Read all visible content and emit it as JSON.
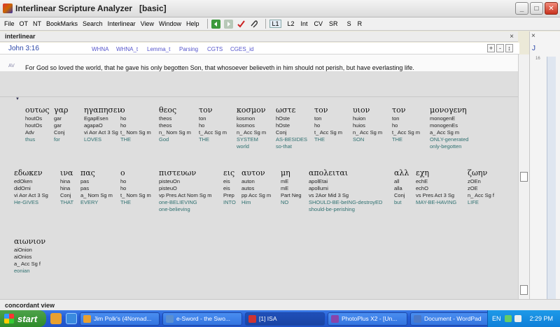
{
  "window": {
    "title": "Interlinear Scripture Analyzer   [basic]",
    "controls": {
      "minimize": "_",
      "maximize": "□",
      "close": "✕"
    }
  },
  "menu": [
    "File",
    "OT",
    "NT",
    "BookMarks",
    "Search",
    "Interlinear",
    "View",
    "Window",
    "Help"
  ],
  "toolbar_icons": [
    "arrow-left-icon",
    "arrow-right-icon",
    "check-icon",
    "paperclip-icon"
  ],
  "toolbar_buttons": [
    "L1",
    "L2",
    "Int",
    "CV",
    "SR",
    "S",
    "R"
  ],
  "panel": {
    "title": "interlinear",
    "close": "×"
  },
  "reference": "John 3:16",
  "ref_links": [
    "WHNA",
    "WHNA_t",
    "Lemma_t",
    "Parsing",
    "CGTS",
    "CGES_id"
  ],
  "ref_controls": [
    "+",
    "-",
    "↕",
    "+"
  ],
  "verse": {
    "version": "AV",
    "text": "For God so loved the world, that he gave his only begotten Son, that whosoever believeth in him should not perish, but have everlasting life."
  },
  "words_row1": [
    {
      "gk": "ουτως",
      "l1": "houtOs",
      "l2": "houtOs",
      "parse": "Adv",
      "en": "thus",
      "en2": ""
    },
    {
      "gk": "γαρ",
      "l1": "gar",
      "l2": "gar",
      "parse": "Conj",
      "en": "for",
      "en2": ""
    },
    {
      "gk": "ηγαπησεν",
      "l1": "EgapEsen",
      "l2": "agapaO",
      "parse": "vi Aor Act 3 Sg",
      "en": "LOVES",
      "en2": ""
    },
    {
      "gk": "ο",
      "l1": "ho",
      "l2": "ho",
      "parse": "t_ Nom Sg m",
      "en": "THE",
      "en2": ""
    },
    {
      "gk": "θεος",
      "l1": "theos",
      "l2": "theos",
      "parse": "n_ Nom Sg m",
      "en": "God",
      "en2": ""
    },
    {
      "gk": "τον",
      "l1": "ton",
      "l2": "ho",
      "parse": "t_ Acc Sg m",
      "en": "THE",
      "en2": ""
    },
    {
      "gk": "κοσμον",
      "l1": "kosmon",
      "l2": "kosmos",
      "parse": "n_ Acc Sg m",
      "en": "SYSTEM",
      "en2": "world"
    },
    {
      "gk": "ωστε",
      "l1": "hOste",
      "l2": "hOste",
      "parse": "Conj",
      "en": "AS-BESIDES",
      "en2": "so-that"
    },
    {
      "gk": "τον",
      "l1": "ton",
      "l2": "ho",
      "parse": "t_ Acc Sg m",
      "en": "THE",
      "en2": ""
    },
    {
      "gk": "υιον",
      "l1": "huion",
      "l2": "huios",
      "parse": "n_ Acc Sg m",
      "en": "SON",
      "en2": ""
    },
    {
      "gk": "τον",
      "l1": "ton",
      "l2": "ho",
      "parse": "t_ Acc Sg m",
      "en": "THE",
      "en2": ""
    },
    {
      "gk": "μονογενη",
      "l1": "monogenE",
      "l2": "monogenEs",
      "parse": "a_ Acc Sg m",
      "en": "ONLY-generated",
      "en2": "only-begotten"
    }
  ],
  "words_row2": [
    {
      "gk": "εδωκεν",
      "l1": "edOken",
      "l2": "didOmi",
      "parse": "vi Aor Act 3 Sg",
      "en": "He-GIVES",
      "en2": ""
    },
    {
      "gk": "ινα",
      "l1": "hina",
      "l2": "hina",
      "parse": "Conj",
      "en": "THAT",
      "en2": ""
    },
    {
      "gk": "πας",
      "l1": "pas",
      "l2": "pas",
      "parse": "a_ Nom Sg m",
      "en": "EVERY",
      "en2": ""
    },
    {
      "gk": "ο",
      "l1": "ho",
      "l2": "ho",
      "parse": "t_ Nom Sg m",
      "en": "THE",
      "en2": ""
    },
    {
      "gk": "πιστευων",
      "l1": "pisteuOn",
      "l2": "pisteuO",
      "parse": "vp Pres Act Nom Sg m",
      "en": "one-BELIEVING",
      "en2": "one-believing"
    },
    {
      "gk": "εις",
      "l1": "eis",
      "l2": "eis",
      "parse": "Prep",
      "en": "INTO",
      "en2": ""
    },
    {
      "gk": "αυτον",
      "l1": "auton",
      "l2": "autos",
      "parse": "pp Acc Sg m",
      "en": "Him",
      "en2": ""
    },
    {
      "gk": "μη",
      "l1": "mE",
      "l2": "mE",
      "parse": "Part Neg",
      "en": "NO",
      "en2": ""
    },
    {
      "gk": "απολειται",
      "l1": "apolEtai",
      "l2": "apollumi",
      "parse": "vs 2Aor Mid 3 Sg",
      "en": "SHOULD-BE-beING-destroyED",
      "en2": "should-be-perishing"
    },
    {
      "gk": "αλλ",
      "l1": "all",
      "l2": "alla",
      "parse": "Conj",
      "en": "but",
      "en2": ""
    },
    {
      "gk": "εχη",
      "l1": "echE",
      "l2": "echO",
      "parse": "vs Pres Act 3 Sg",
      "en": "MAY-BE-HAVING",
      "en2": ""
    },
    {
      "gk": "ζωην",
      "l1": "zOEn",
      "l2": "zOE",
      "parse": "n_ Acc Sg f",
      "en": "LIFE",
      "en2": ""
    }
  ],
  "words_row3": [
    {
      "gk": "αιωνιον",
      "l1": "aiOnion",
      "l2": "aiOnios",
      "parse": "a_ Acc Sg f",
      "en": "eonian",
      "en2": ""
    }
  ],
  "right_panel": {
    "close": "×",
    "ref": "J",
    "num": "16"
  },
  "concordance": {
    "title": "concordant view"
  },
  "taskbar": {
    "start": "start",
    "tasks": [
      "Jim Polk's (4Nomad...",
      "e-Sword - the Swo...",
      "[1] ISA",
      "PhotoPlus X2 - [Un...",
      "Document - WordPad"
    ],
    "active_task": 2,
    "lang": "EN",
    "clock": "2:29 PM"
  }
}
